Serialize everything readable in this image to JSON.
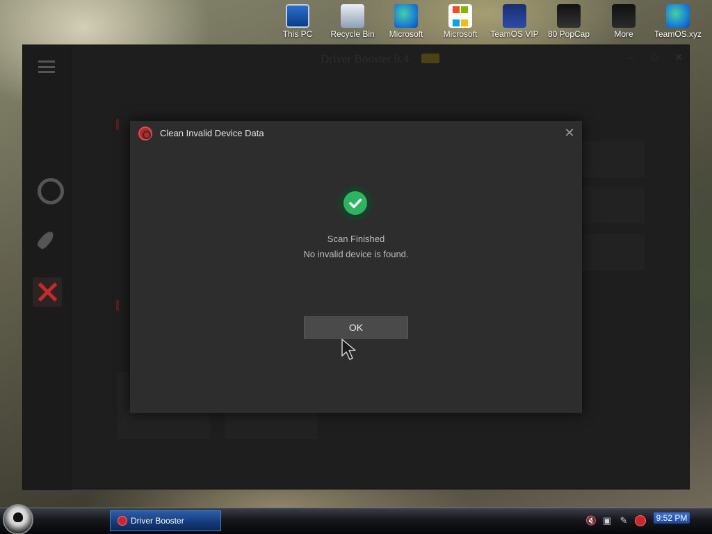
{
  "desktop": {
    "icons": [
      {
        "label": "This PC",
        "icon": "computer-icon"
      },
      {
        "label": "Recycle Bin",
        "icon": "recycle-bin-icon"
      },
      {
        "label": "Microsoft Edge",
        "icon": "edge-icon"
      },
      {
        "label": "Microsoft Store",
        "icon": "store-icon"
      },
      {
        "label": "TeamOS VIP Installer",
        "icon": "teamos-icon"
      },
      {
        "label": "80 PopCap Games",
        "icon": "popcap-icon"
      },
      {
        "label": "More",
        "icon": "folder-icon"
      },
      {
        "label": "TeamOS.xyz",
        "icon": "edge-icon"
      }
    ]
  },
  "app": {
    "title": "Driver Booster 9.4",
    "badge": "PRO"
  },
  "dialog": {
    "title": "Clean Invalid Device Data",
    "close_glyph": "✕",
    "status_title": "Scan Finished",
    "status_message": "No invalid device is found.",
    "ok_label": "OK",
    "colors": {
      "success": "#2bb561",
      "accent": "#c8282c"
    }
  },
  "taskbar": {
    "active_task": "Driver Booster",
    "clock": "9:52 PM"
  }
}
